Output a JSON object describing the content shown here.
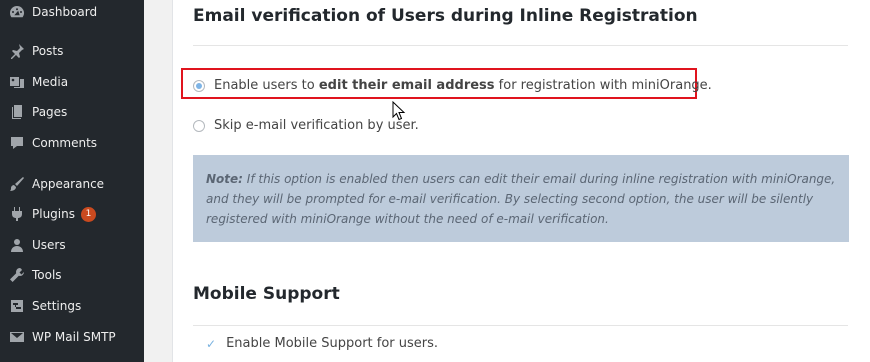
{
  "sidebar": {
    "items": [
      {
        "label": "Dashboard",
        "icon": "dashboard-icon"
      },
      {
        "label": "Posts",
        "icon": "pin-icon"
      },
      {
        "label": "Media",
        "icon": "media-icon"
      },
      {
        "label": "Pages",
        "icon": "pages-icon"
      },
      {
        "label": "Comments",
        "icon": "comment-icon"
      },
      {
        "label": "Appearance",
        "icon": "brush-icon"
      },
      {
        "label": "Plugins",
        "icon": "plugin-icon",
        "badge": "1"
      },
      {
        "label": "Users",
        "icon": "user-icon"
      },
      {
        "label": "Tools",
        "icon": "wrench-icon"
      },
      {
        "label": "Settings",
        "icon": "settings-icon"
      },
      {
        "label": "WP Mail SMTP",
        "icon": "mail-icon"
      }
    ]
  },
  "email_section": {
    "heading": "Email verification of Users during Inline Registration",
    "option1": {
      "prefix": "Enable users to ",
      "bold": "edit their email address",
      "suffix": " for registration with miniOrange.",
      "checked": true
    },
    "option2": {
      "label": "Skip e-mail verification by user.",
      "checked": false
    },
    "note": {
      "label": "Note:",
      "text": " If this option is enabled then users can edit their email during inline registration with miniOrange, and they will be prompted for e-mail verification. By selecting second option, the user will be silently registered with miniOrange without the need of e-mail verification."
    }
  },
  "mobile_section": {
    "heading": "Mobile Support",
    "checkbox_label": "Enable Mobile Support for users.",
    "checked": true
  },
  "colors": {
    "sidebar_bg": "#23282d",
    "highlight_border": "#e0141e",
    "note_bg": "#bdcbdb",
    "badge_bg": "#ca4a1f"
  }
}
